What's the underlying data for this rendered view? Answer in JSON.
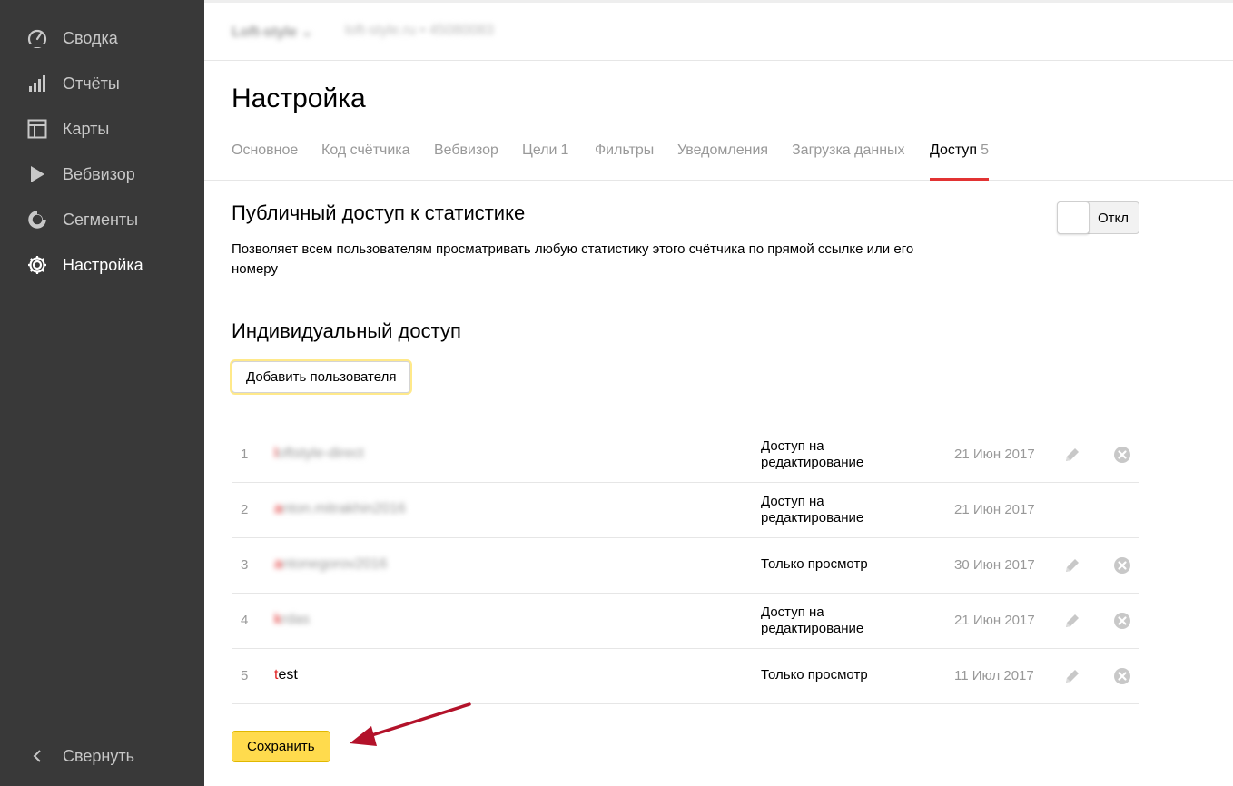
{
  "sidebar": {
    "items": [
      {
        "label": "Сводка",
        "icon": "dashboard-icon"
      },
      {
        "label": "Отчёты",
        "icon": "reports-bars-icon"
      },
      {
        "label": "Карты",
        "icon": "maps-layout-icon"
      },
      {
        "label": "Вебвизор",
        "icon": "play-icon"
      },
      {
        "label": "Сегменты",
        "icon": "segments-ring-icon"
      },
      {
        "label": "Настройка",
        "icon": "gear-icon",
        "active": true
      }
    ],
    "collapse_label": "Свернуть"
  },
  "topbar": {
    "counter_name": "Loft-style",
    "counter_info": "loft-style.ru  •  45080083"
  },
  "page": {
    "title": "Настройка"
  },
  "tabs": [
    {
      "label": "Основное",
      "count": ""
    },
    {
      "label": "Код счётчика",
      "count": ""
    },
    {
      "label": "Вебвизор",
      "count": ""
    },
    {
      "label": "Цели",
      "count": "1"
    },
    {
      "label": "Фильтры",
      "count": ""
    },
    {
      "label": "Уведомления",
      "count": ""
    },
    {
      "label": "Загрузка данных",
      "count": ""
    },
    {
      "label": "Доступ",
      "count": "5",
      "active": true
    }
  ],
  "public_access": {
    "title": "Публичный доступ к статистике",
    "description": "Позволяет всем пользователям просматривать любую статистику этого счётчика по прямой ссылке или его номеру",
    "toggle_label": "Откл"
  },
  "individual_access": {
    "title": "Индивидуальный доступ",
    "add_button": "Добавить пользователя"
  },
  "users": [
    {
      "num": "1",
      "login_first": "l",
      "login_rest": "oftstyle-direct",
      "access": "Доступ на редактирование",
      "date": "21 Июн 2017",
      "editable": true,
      "removable": true,
      "blurred": true
    },
    {
      "num": "2",
      "login_first": "a",
      "login_rest": "nton.mitrakhin2016",
      "access": "Доступ на редактирование",
      "date": "21 Июн 2017",
      "editable": false,
      "removable": false,
      "blurred": true
    },
    {
      "num": "3",
      "login_first": "a",
      "login_rest": "ntonegorov2016",
      "access": "Только просмотр",
      "date": "30 Июн 2017",
      "editable": true,
      "removable": true,
      "blurred": true
    },
    {
      "num": "4",
      "login_first": "k",
      "login_rest": "rdas",
      "access": "Доступ на редактирование",
      "date": "21 Июн 2017",
      "editable": true,
      "removable": true,
      "blurred": true
    },
    {
      "num": "5",
      "login_first": "t",
      "login_rest": "est",
      "access": "Только просмотр",
      "date": "11 Июл 2017",
      "editable": true,
      "removable": true,
      "blurred": false
    }
  ],
  "save_button": "Сохранить",
  "colors": {
    "sidebar_bg": "#393939",
    "accent_red": "#e23333",
    "save_yellow": "#ffdb4d",
    "annotation_arrow": "#b3122a"
  }
}
